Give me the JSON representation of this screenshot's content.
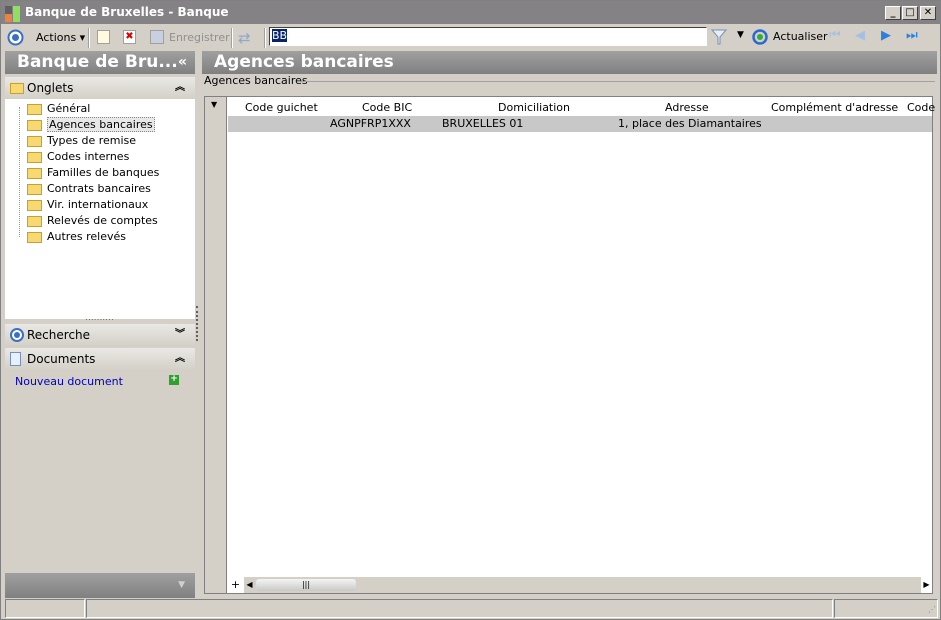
{
  "window": {
    "title": "Banque de Bruxelles -  Banque",
    "minimize": "_",
    "maximize": "□",
    "close": "✕"
  },
  "toolbar": {
    "actions": "Actions",
    "save": "Enregistrer",
    "search_value": "BB",
    "refresh": "Actualiser"
  },
  "left": {
    "title": "Banque de Bru...",
    "collapse": "«",
    "onglets": "Onglets",
    "tabs": [
      "Général",
      "Agences bancaires",
      "Types de remise",
      "Codes internes",
      "Familles de banques",
      "Contrats bancaires",
      "Vir. internationaux",
      "Relevés de comptes",
      "Autres relevés"
    ],
    "selected": 1,
    "recherche": "Recherche",
    "documents": "Documents",
    "new_doc": "Nouveau document"
  },
  "main": {
    "title": "Agences bancaires",
    "group_label": "Agences bancaires",
    "columns": [
      "Code guichet",
      "Code BIC",
      "Domiciliation",
      "Adresse",
      "Complément d'adresse",
      "Code"
    ],
    "rows": [
      [
        "",
        "AGNPFRP1XXX",
        "BRUXELLES 01",
        "1, place des Diamantaires",
        "",
        ""
      ]
    ]
  },
  "colors": {
    "header": "#848284",
    "selected_row": "#c8c8c8"
  }
}
